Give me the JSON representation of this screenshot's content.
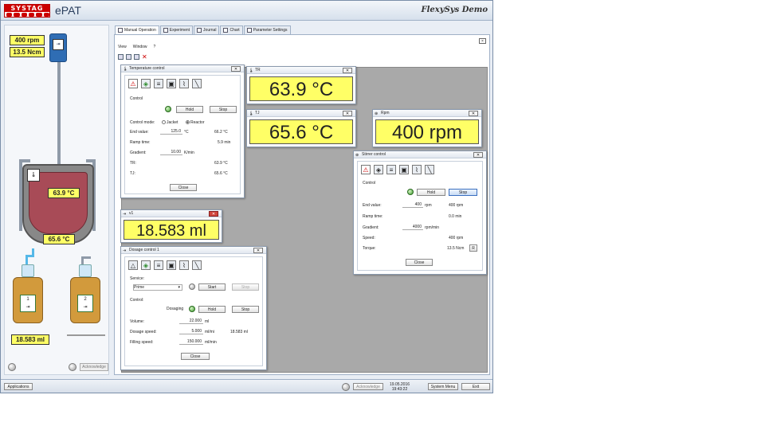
{
  "app": {
    "brand": "SYSTAG",
    "title": "ePAT",
    "demo": "FlexySys Demo"
  },
  "left_panel": {
    "rpm": "400 rpm",
    "torque": "13.5 Ncm",
    "tr": "63.9 °C",
    "tj": "65.6 °C",
    "bottle1_label": "1",
    "bottle2_label": "2",
    "bottle1_value": "18.583 ml",
    "acknowledge": "Acknowledge"
  },
  "tabs": [
    {
      "label": "Manual Operation",
      "active": true
    },
    {
      "label": "Experiment"
    },
    {
      "label": "Journal"
    },
    {
      "label": "Chart"
    },
    {
      "label": "Parameter Settings"
    }
  ],
  "menu": {
    "view": "View",
    "window": "Window",
    "help": "?"
  },
  "temperature_control": {
    "title": "Temperature control",
    "control": "Control",
    "hold": "Hold",
    "stop": "Stop",
    "control_mode": "Control mode:",
    "jacket": "Jacket",
    "reactor": "Reactor",
    "end_value_label": "End value:",
    "end_value": "125.0",
    "end_unit": "°C",
    "end_actual": "66.2 °C",
    "ramp_label": "Ramp time:",
    "ramp_actual": "5.9 min",
    "gradient_label": "Gradient:",
    "gradient": "10.00",
    "gradient_unit": "K/min",
    "tr_label": "TR:",
    "tr_value": "63.9 °C",
    "tj_label": "TJ:",
    "tj_value": "65.6 °C",
    "close": "Close"
  },
  "tr_window": {
    "title": "TR",
    "value": "63.9 °C"
  },
  "tj_window": {
    "title": "TJ",
    "value": "65.6 °C"
  },
  "rpm_window": {
    "title": "Rpm",
    "value": "400 rpm"
  },
  "v1_window": {
    "title": "v1",
    "value": "18.583 ml"
  },
  "stirrer_control": {
    "title": "Stirrer control",
    "control": "Control",
    "hold": "Hold",
    "stop": "Stop",
    "end_value_label": "End value:",
    "end_value": "400",
    "end_unit": "rpm",
    "end_actual": "400 rpm",
    "ramp_label": "Ramp time:",
    "ramp_actual": "0.0 min",
    "gradient_label": "Gradient:",
    "gradient": "4000",
    "gradient_unit": "rpm/min",
    "speed_label": "Speed:",
    "speed_value": "400 rpm",
    "torque_label": "Torque:",
    "torque_value": "13.5 Ncm",
    "torque_btn": "R",
    "close": "Close"
  },
  "dosage_control": {
    "title": "Dosage control 1",
    "service": "Service:",
    "service_value": "Prime",
    "start": "Start",
    "stop": "Stop",
    "control": "Control:",
    "dosaging": "Dosaging",
    "hold": "Hold",
    "stop2": "Stop",
    "volume_label": "Volume:",
    "volume": "22.000",
    "volume_unit": "ml",
    "speed_label": "Dosage speed:",
    "speed": "5.000",
    "speed_unit": "ml/mi",
    "speed_actual": "18.583 ml",
    "filling_label": "Filling speed:",
    "filling": "150.000",
    "filling_unit": "ml/min",
    "close": "Close"
  },
  "statusbar": {
    "applications": "Applications",
    "acknowledge": "Acknowledge",
    "date": "19.05.2016",
    "time": "19:43:22",
    "system_menu": "System Menu",
    "exit": "Exit"
  }
}
